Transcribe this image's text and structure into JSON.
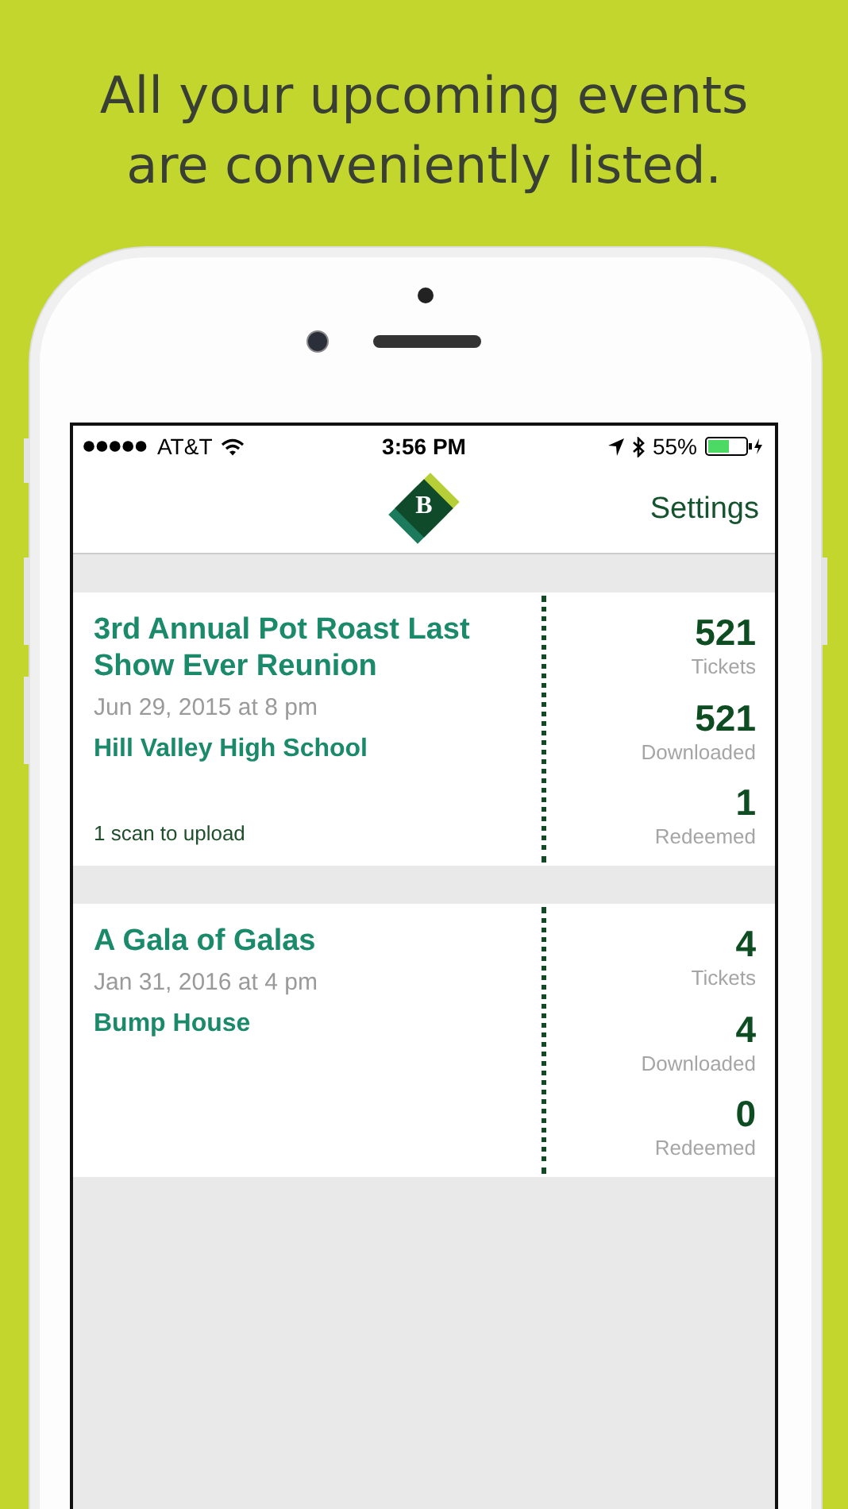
{
  "headline": [
    "All your upcoming events",
    "are conveniently listed."
  ],
  "status_bar": {
    "carrier": "AT&T",
    "time": "3:56 PM",
    "battery": "55%"
  },
  "nav": {
    "logo_letter": "B",
    "settings": "Settings"
  },
  "events": [
    {
      "title": "3rd Annual Pot Roast Last Show Ever Reunion",
      "date": "Jun 29, 2015 at 8 pm",
      "venue": "Hill Valley High School",
      "note": "1 scan to upload",
      "stats": [
        {
          "value": "521",
          "label": "Tickets"
        },
        {
          "value": "521",
          "label": "Downloaded"
        },
        {
          "value": "1",
          "label": "Redeemed"
        }
      ]
    },
    {
      "title": "A Gala of Galas",
      "date": "Jan 31, 2016 at 4 pm",
      "venue": "Bump House",
      "stats": [
        {
          "value": "4",
          "label": "Tickets"
        },
        {
          "value": "4",
          "label": "Downloaded"
        },
        {
          "value": "0",
          "label": "Redeemed"
        }
      ]
    }
  ]
}
